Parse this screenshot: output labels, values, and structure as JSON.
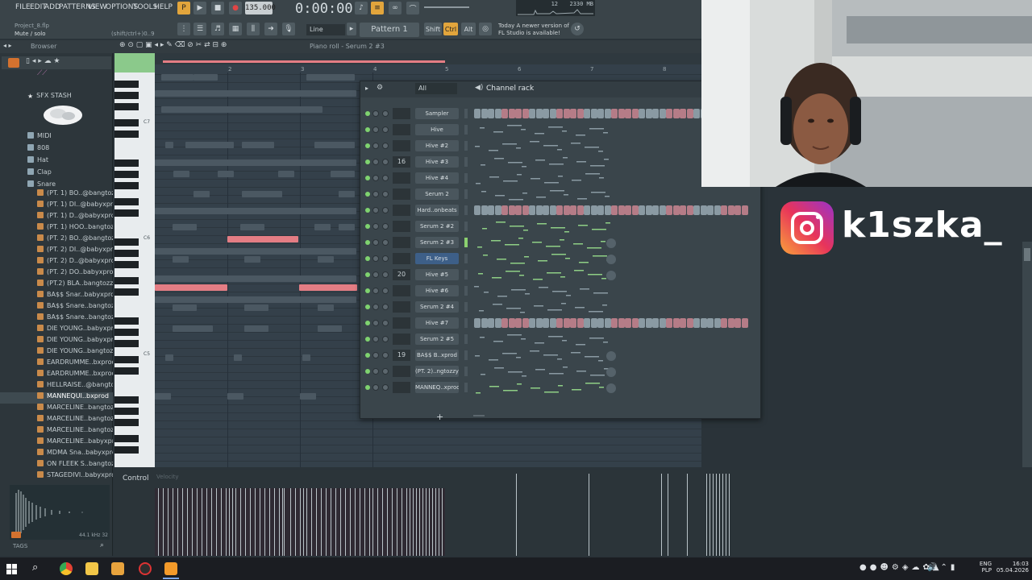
{
  "menu": [
    "FILE",
    "EDIT",
    "ADD",
    "PATTERNS",
    "VIEW",
    "OPTIONS",
    "TOOLS",
    "HELP"
  ],
  "hint": {
    "project": "Project_8.flp",
    "status": "Mute / solo",
    "shortcut": "(shift/ctrl+)0..9"
  },
  "transport": {
    "tempo": "135.000",
    "time": "0:00:00",
    "memory": "2330 MB",
    "cpu": "12"
  },
  "snap": "Line",
  "pattern": "Pattern 1",
  "modifiers": {
    "shift": "Shift",
    "ctrl": "Ctrl",
    "alt": "Alt"
  },
  "news": {
    "line1": "Today   A newer version of",
    "line2": "FL Studio is available!"
  },
  "toolbar2": {
    "browser_label": "Browser",
    "pianoroll_label": "Piano roll - Serum 2 #3"
  },
  "browser": {
    "items": [
      {
        "label": "SFX STASH",
        "type": "star"
      },
      {
        "label": "MIDI",
        "type": "folder"
      },
      {
        "label": "808",
        "type": "folder"
      },
      {
        "label": "Hat",
        "type": "folder"
      },
      {
        "label": "Clap",
        "type": "folder"
      },
      {
        "label": "Snare",
        "type": "folder"
      },
      {
        "label": "(PT. 1) BO..@bangtozzy",
        "type": "file"
      },
      {
        "label": "(PT. 1) DI..@babyxprod",
        "type": "file"
      },
      {
        "label": "(PT. 1) D..@babyxprod",
        "type": "file"
      },
      {
        "label": "(PT. 1) HOO..bangtozzy",
        "type": "file"
      },
      {
        "label": "(PT. 2) BO..@bangtozzy",
        "type": "file"
      },
      {
        "label": "(PT. 2) DI..@babyxprod",
        "type": "file"
      },
      {
        "label": "(PT. 2) D..@babyxprod",
        "type": "file"
      },
      {
        "label": "(PT. 2) DO..babyxprod",
        "type": "file"
      },
      {
        "label": "(PT.2) BLA..bangtozzy",
        "type": "file"
      },
      {
        "label": "BA$$ Snar..babyxprod",
        "type": "file"
      },
      {
        "label": "BA$$ Snare..bangtozzy",
        "type": "file"
      },
      {
        "label": "BA$$ Snare..bangtozzy",
        "type": "file"
      },
      {
        "label": "DIE YOUNG..babyxprod",
        "type": "file"
      },
      {
        "label": "DIE YOUNG..babyxprod",
        "type": "file"
      },
      {
        "label": "DIE YOUNG..bangtozzy",
        "type": "file"
      },
      {
        "label": "EARDRUMME..bxprod",
        "type": "file"
      },
      {
        "label": "EARDRUMME..bxprod",
        "type": "file"
      },
      {
        "label": "HELLRAISE..@bangtozzy",
        "type": "file"
      },
      {
        "label": "MANNEQUI..bxprod",
        "type": "file",
        "selected": true
      },
      {
        "label": "MARCELINE..bangtozzy",
        "type": "file"
      },
      {
        "label": "MARCELINE..bangtozzy",
        "type": "file"
      },
      {
        "label": "MARCELINE..bangtozzy",
        "type": "file"
      },
      {
        "label": "MARCELINE..babyxprod",
        "type": "file"
      },
      {
        "label": "MDMA Sna..babyxprod",
        "type": "file"
      },
      {
        "label": "ON FLEEK S..bangtozzy",
        "type": "file"
      },
      {
        "label": "STAGEDIVI..babyxprod",
        "type": "file"
      }
    ],
    "sample_info": "44.1 kHz 32",
    "tags_label": "TAGS"
  },
  "pianoroll": {
    "octave_labels": [
      "C7",
      "C6",
      "C5"
    ],
    "bar_numbers": [
      "2",
      "3",
      "4",
      "5",
      "6",
      "7",
      "8"
    ],
    "note_label": "C6"
  },
  "rack": {
    "filter": "All",
    "title": "Channel rack",
    "add_button": "+",
    "channels": [
      {
        "name": "Sampler",
        "mixer": ""
      },
      {
        "name": "Hive",
        "mixer": ""
      },
      {
        "name": "Hive #2",
        "mixer": ""
      },
      {
        "name": "Hive #3",
        "mixer": "16"
      },
      {
        "name": "Hive #4",
        "mixer": ""
      },
      {
        "name": "Serum 2",
        "mixer": ""
      },
      {
        "name": "Hard..onbeats",
        "mixer": ""
      },
      {
        "name": "Serum 2 #2",
        "mixer": ""
      },
      {
        "name": "Serum 2 #3",
        "mixer": ""
      },
      {
        "name": "FL Keys",
        "mixer": "",
        "selected": true
      },
      {
        "name": "Hive #5",
        "mixer": "20"
      },
      {
        "name": "Hive #6",
        "mixer": ""
      },
      {
        "name": "Serum 2 #4",
        "mixer": ""
      },
      {
        "name": "Hive #7",
        "mixer": ""
      },
      {
        "name": "Serum 2 #5",
        "mixer": ""
      },
      {
        "name": "BA$$ B..xprod",
        "mixer": "19"
      },
      {
        "name": "(PT. 2)..ngtozzy",
        "mixer": ""
      },
      {
        "name": "MANNEQ..xprod",
        "mixer": ""
      }
    ]
  },
  "control": {
    "label": "Control",
    "sublabel": "Velocity"
  },
  "overlay": {
    "handle": "k1szka_"
  },
  "taskbar": {
    "lang": "ENG",
    "region": "PLP",
    "time": "16:03",
    "date": "05.04.2026"
  },
  "colors": {
    "accent": "#e47d84",
    "selected": "#3d5f88",
    "steps": "#8a9aa3"
  }
}
